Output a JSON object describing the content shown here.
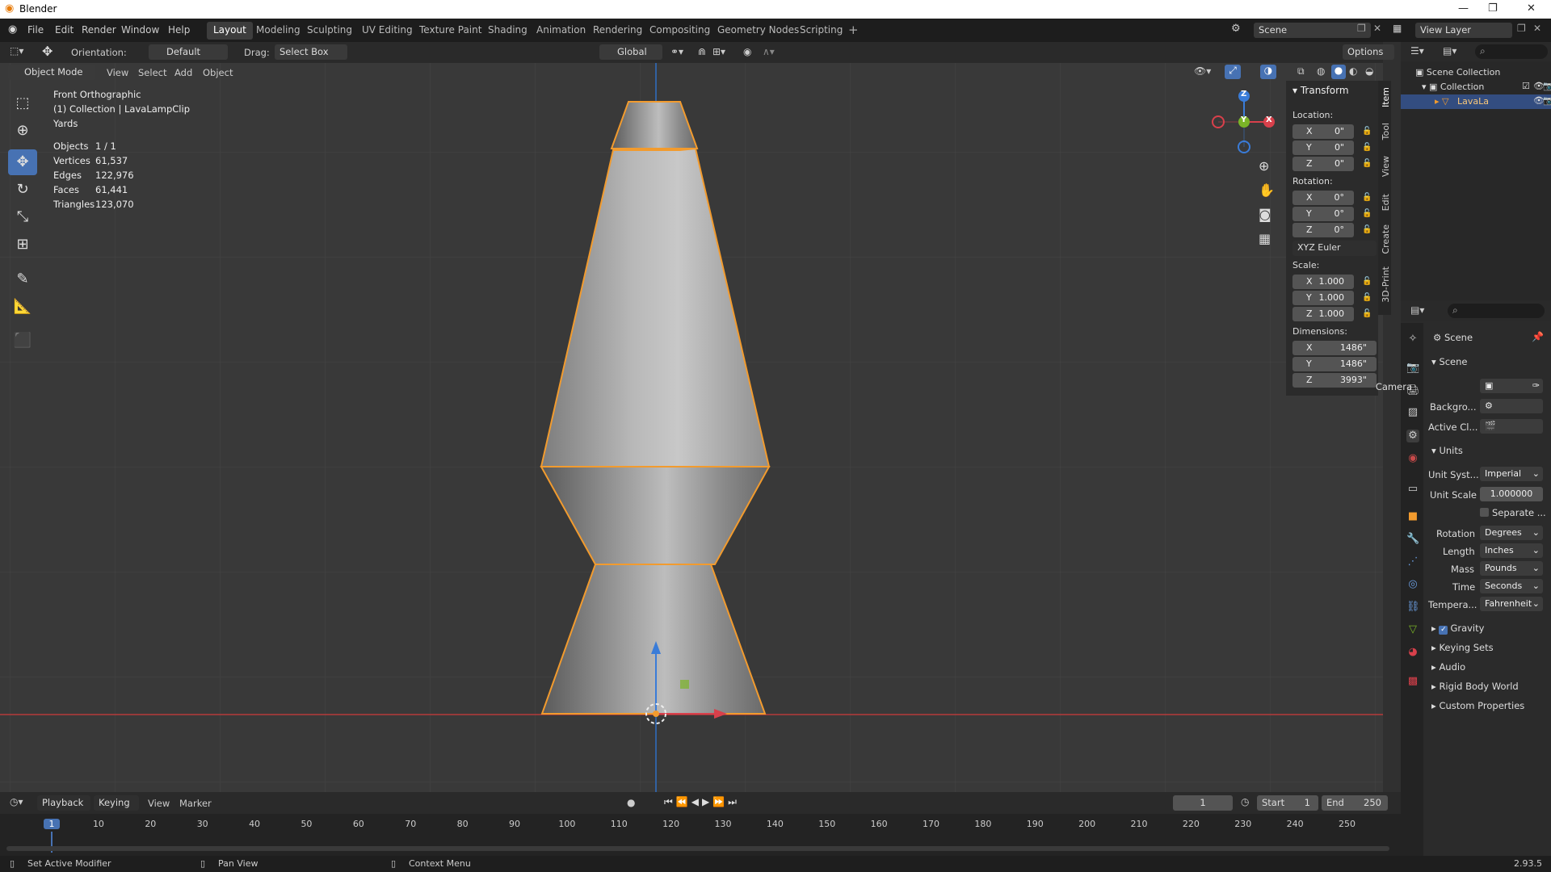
{
  "app": {
    "title": "Blender",
    "version": "2.93.5"
  },
  "menu": [
    "File",
    "Edit",
    "Render",
    "Window",
    "Help"
  ],
  "workspaces": [
    "Layout",
    "Modeling",
    "Sculpting",
    "UV Editing",
    "Texture Paint",
    "Shading",
    "Animation",
    "Rendering",
    "Compositing",
    "Geometry Nodes",
    "Scripting"
  ],
  "active_workspace": "Layout",
  "scene_field": "Scene",
  "view_layer_field": "View Layer",
  "header": {
    "orientation_label": "Orientation:",
    "orientation_value": "Default",
    "drag_label": "Drag:",
    "drag_value": "Select Box",
    "transform_orientation": "Global",
    "options": "Options"
  },
  "viewport_header": {
    "mode": "Object Mode",
    "menus": [
      "View",
      "Select",
      "Add",
      "Object"
    ]
  },
  "viewport_info": {
    "view": "Front Orthographic",
    "collection": "(1) Collection | LavaLampClip",
    "units": "Yards"
  },
  "stats": [
    {
      "label": "Objects",
      "value": "1 / 1"
    },
    {
      "label": "Vertices",
      "value": "61,537"
    },
    {
      "label": "Edges",
      "value": "122,976"
    },
    {
      "label": "Faces",
      "value": "61,441"
    },
    {
      "label": "Triangles",
      "value": "123,070"
    }
  ],
  "gizmo": {
    "z": "Z",
    "y": "Y",
    "x": "X"
  },
  "transform": {
    "title": "Transform",
    "location_label": "Location:",
    "location": [
      {
        "axis": "X",
        "value": "0\""
      },
      {
        "axis": "Y",
        "value": "0\""
      },
      {
        "axis": "Z",
        "value": "0\""
      }
    ],
    "rotation_label": "Rotation:",
    "rotation": [
      {
        "axis": "X",
        "value": "0°"
      },
      {
        "axis": "Y",
        "value": "0°"
      },
      {
        "axis": "Z",
        "value": "0°"
      }
    ],
    "rotation_mode": "XYZ Euler",
    "scale_label": "Scale:",
    "scale": [
      {
        "axis": "X",
        "value": "1.000"
      },
      {
        "axis": "Y",
        "value": "1.000"
      },
      {
        "axis": "Z",
        "value": "1.000"
      }
    ],
    "dimensions_label": "Dimensions:",
    "dimensions": [
      {
        "axis": "X",
        "value": "1486\""
      },
      {
        "axis": "Y",
        "value": "1486\""
      },
      {
        "axis": "Z",
        "value": "3993\""
      }
    ]
  },
  "side_tabs": [
    "Item",
    "Tool",
    "View",
    "Edit",
    "Create",
    "3D-Print"
  ],
  "outliner": {
    "root": "Scene Collection",
    "collection": "Collection",
    "object": "LavaLa"
  },
  "properties": {
    "header": "Scene",
    "scene_section": "Scene",
    "camera_label": "Camera",
    "background_label": "Backgro...",
    "active_clip_label": "Active Cl...",
    "units_section": "Units",
    "unit_system_label": "Unit Syst...",
    "unit_system": "Imperial",
    "unit_scale_label": "Unit Scale",
    "unit_scale": "1.000000",
    "separate_label": "Separate ...",
    "rotation_label": "Rotation",
    "rotation": "Degrees",
    "length_label": "Length",
    "length": "Inches",
    "mass_label": "Mass",
    "mass": "Pounds",
    "time_label": "Time",
    "time": "Seconds",
    "temperature_label": "Tempera...",
    "temperature": "Fahrenheit",
    "collapsed": [
      "Gravity",
      "Keying Sets",
      "Audio",
      "Rigid Body World",
      "Custom Properties"
    ]
  },
  "timeline": {
    "menus": [
      "Playback",
      "Keying",
      "View",
      "Marker"
    ],
    "current_frame": "1",
    "start_label": "Start",
    "start": "1",
    "end_label": "End",
    "end": "250",
    "ticks": [
      "1",
      "10",
      "20",
      "30",
      "40",
      "50",
      "60",
      "70",
      "80",
      "90",
      "100",
      "110",
      "120",
      "130",
      "140",
      "150",
      "160",
      "170",
      "180",
      "190",
      "200",
      "210",
      "220",
      "230",
      "240",
      "250"
    ]
  },
  "statusbar": [
    "Set Active Modifier",
    "Pan View",
    "Context Menu"
  ],
  "colors": {
    "accent": "#4772b3",
    "selection": "#f29b2e",
    "x_axis": "#d8404b",
    "y_axis": "#7ab427",
    "z_axis": "#3a7cd8"
  }
}
